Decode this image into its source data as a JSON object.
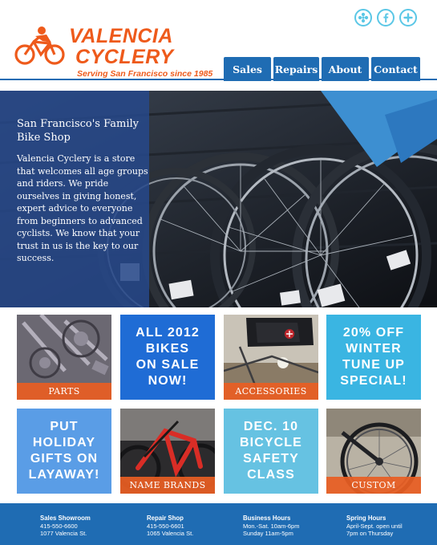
{
  "brand": {
    "line1": "VALENCIA",
    "line2": "CYCLERY",
    "tagline": "Serving San Francisco since 1985",
    "color": "#ee5a1b"
  },
  "social": [
    {
      "icon": "flower-icon"
    },
    {
      "icon": "facebook-icon"
    },
    {
      "icon": "plus-icon"
    }
  ],
  "nav": {
    "items": [
      {
        "label": "Sales"
      },
      {
        "label": "Repairs"
      },
      {
        "label": "About"
      },
      {
        "label": "Contact"
      }
    ],
    "color": "#1f6cb3"
  },
  "hero": {
    "title": "San Francisco's Family Bike Shop",
    "body": "Valencia Cyclery is a store that welcomes all age groups and riders. We pride ourselves in giving honest, expert advice to everyone from beginners to advanced cyclists.  We know that your trust in us is the key to our success."
  },
  "tiles": [
    {
      "caption": "PARTS"
    },
    {
      "text": "ALL 2012\nBIKES\nON SALE\nNOW!",
      "color": "#1f6cd5"
    },
    {
      "caption": "ACCESSORIES"
    },
    {
      "text": "20% OFF\nWINTER\nTUNE UP\nSPECIAL!",
      "color": "#3ab5e2"
    },
    {
      "text": "PUT\nHOLIDAY\nGIFTS ON\nLAYAWAY!",
      "color": "#5a9de6"
    },
    {
      "caption": "NAME BRANDS"
    },
    {
      "text": "DEC. 10\nBICYCLE\nSAFETY\nCLASS",
      "color": "#66c2e2"
    },
    {
      "caption": "CUSTOM"
    }
  ],
  "footer": {
    "columns": [
      {
        "heading": "Sales Showroom",
        "line1": "415-550-6600",
        "line2": "1077 Valencia St."
      },
      {
        "heading": "Repair Shop",
        "line1": "415-550-6601",
        "line2": "1065 Valencia St."
      },
      {
        "heading": "Business Hours",
        "line1": "Mon.-Sat. 10am-6pm",
        "line2": "Sunday 11am-5pm"
      },
      {
        "heading": "Spring Hours",
        "line1": "April-Sept. open until",
        "line2": "7pm on Thursday"
      }
    ]
  }
}
